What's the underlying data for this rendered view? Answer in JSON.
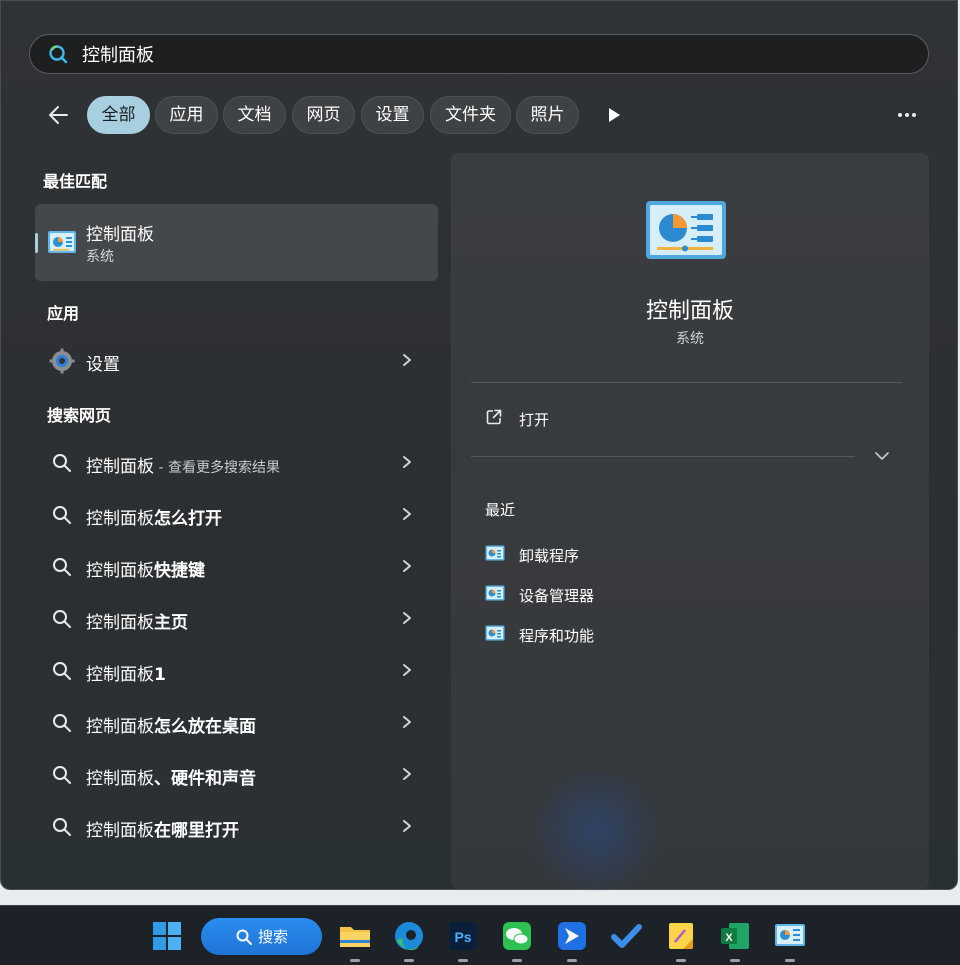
{
  "search": {
    "query": "控制面板"
  },
  "filters": {
    "chips": [
      "全部",
      "应用",
      "文档",
      "网页",
      "设置",
      "文件夹",
      "照片"
    ],
    "active_index": 0
  },
  "best_match": {
    "title": "最佳匹配",
    "name": "控制面板",
    "category": "系统"
  },
  "apps": {
    "title": "应用",
    "items": [
      {
        "label": "设置",
        "icon": "gear-icon"
      }
    ]
  },
  "web": {
    "title": "搜索网页",
    "items": [
      {
        "prefix": "控制面板",
        "bold": "",
        "sub": " - 查看更多搜索结果"
      },
      {
        "prefix": "控制面板",
        "bold": "怎么打开",
        "sub": ""
      },
      {
        "prefix": "控制面板",
        "bold": "快捷键",
        "sub": ""
      },
      {
        "prefix": "控制面板",
        "bold": "主页",
        "sub": ""
      },
      {
        "prefix": "控制面板",
        "bold": "1",
        "sub": ""
      },
      {
        "prefix": "控制面板",
        "bold": "怎么放在桌面",
        "sub": ""
      },
      {
        "prefix": "控制面板",
        "bold": "、硬件和声音",
        "sub": ""
      },
      {
        "prefix": "控制面板",
        "bold": "在哪里打开",
        "sub": ""
      }
    ]
  },
  "detail": {
    "title": "控制面板",
    "subtitle": "系统",
    "open_label": "打开",
    "recent_title": "最近",
    "recent": [
      "卸载程序",
      "设备管理器",
      "程序和功能"
    ]
  },
  "taskbar": {
    "search_label": "搜索",
    "apps": [
      "start-icon",
      "file-explorer-icon",
      "edge-icon",
      "photoshop-icon",
      "wechat-icon",
      "feishu-icon",
      "todo-icon",
      "sticky-notes-icon",
      "excel-icon",
      "control-panel-icon"
    ]
  },
  "colors": {
    "accent": "#a7cfe0",
    "taskbar_search": "#2a8ef0"
  }
}
